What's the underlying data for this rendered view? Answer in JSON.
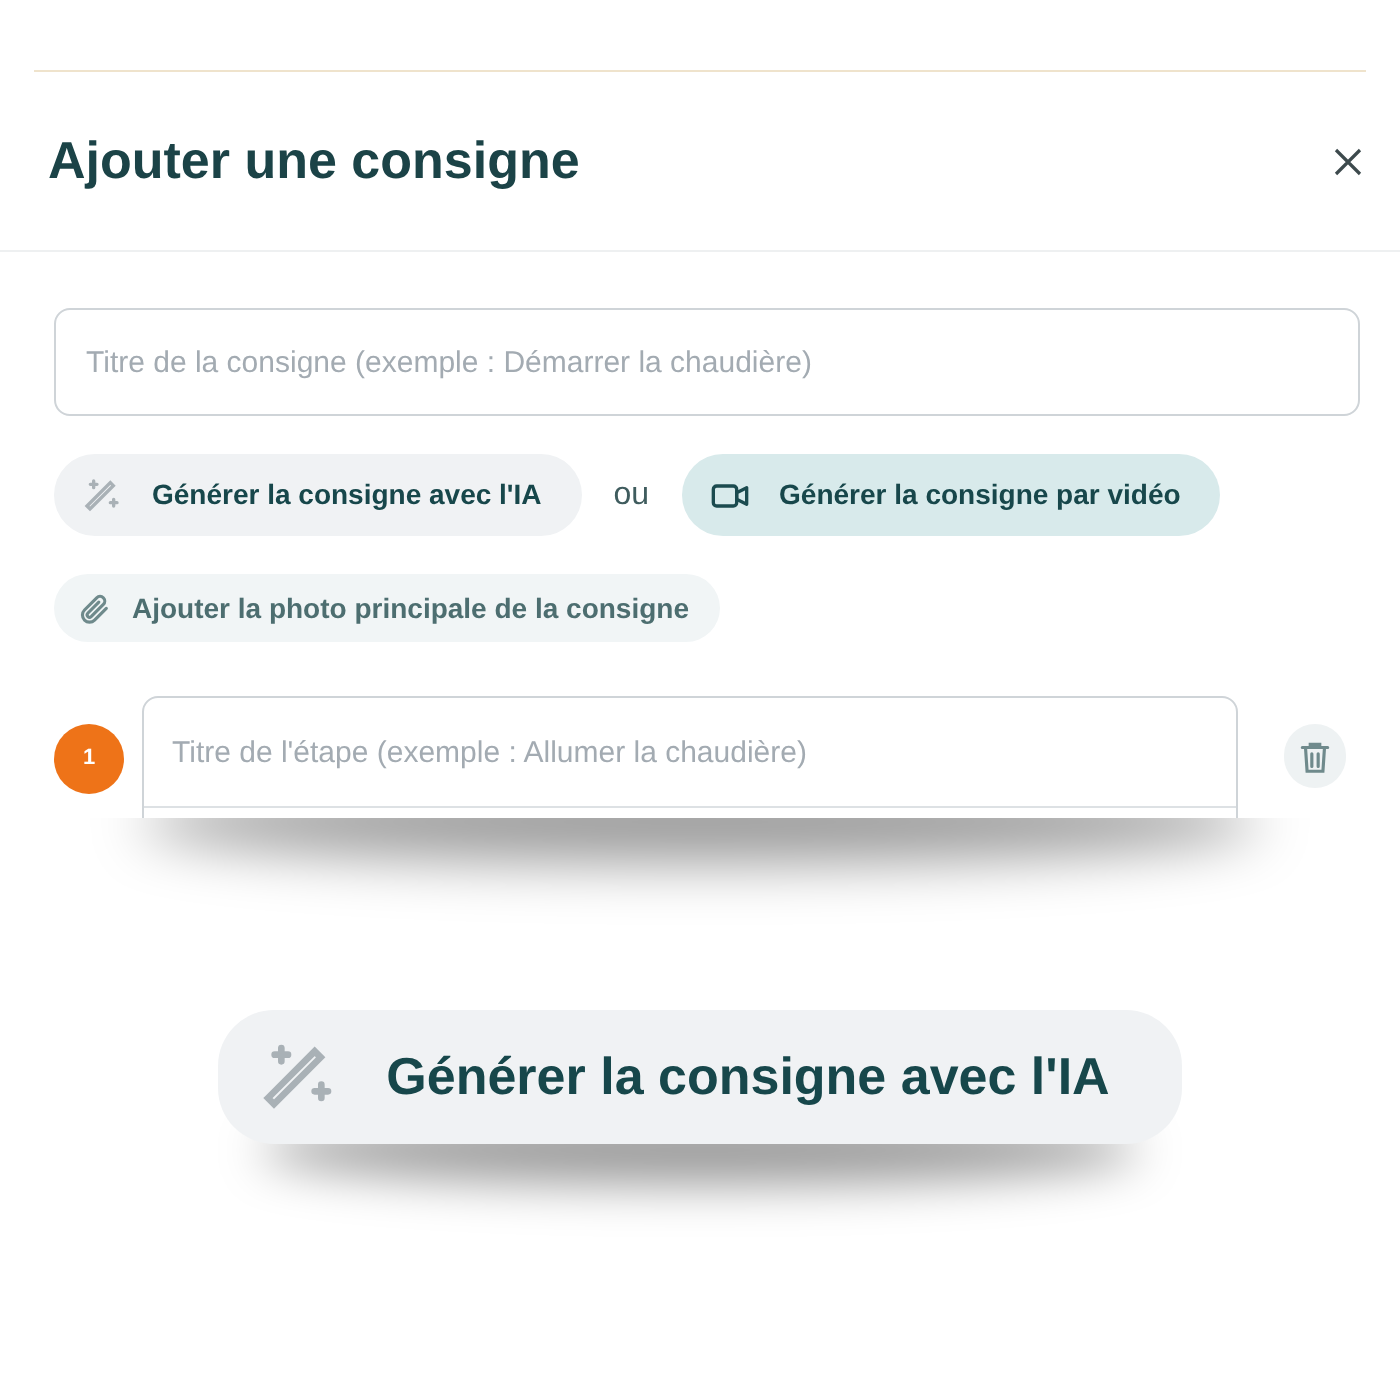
{
  "dialog": {
    "title": "Ajouter une consigne",
    "title_field": {
      "placeholder": "Titre de la consigne (exemple : Démarrer la chaudière)"
    },
    "generate_actions": [
      {
        "kind": "ai",
        "label": "Générer la consigne avec l'IA"
      },
      {
        "kind": "video",
        "label": "Générer la consigne par vidéo"
      }
    ],
    "separator": "ou",
    "photo_button": {
      "label": "Ajouter la photo principale de la consigne"
    },
    "steps": [
      {
        "number": "1",
        "placeholder": "Titre de l'étape (exemple : Allumer la chaudière)"
      }
    ]
  },
  "callout": {
    "kind": "ai",
    "label": "Générer la consigne avec l'IA"
  }
}
